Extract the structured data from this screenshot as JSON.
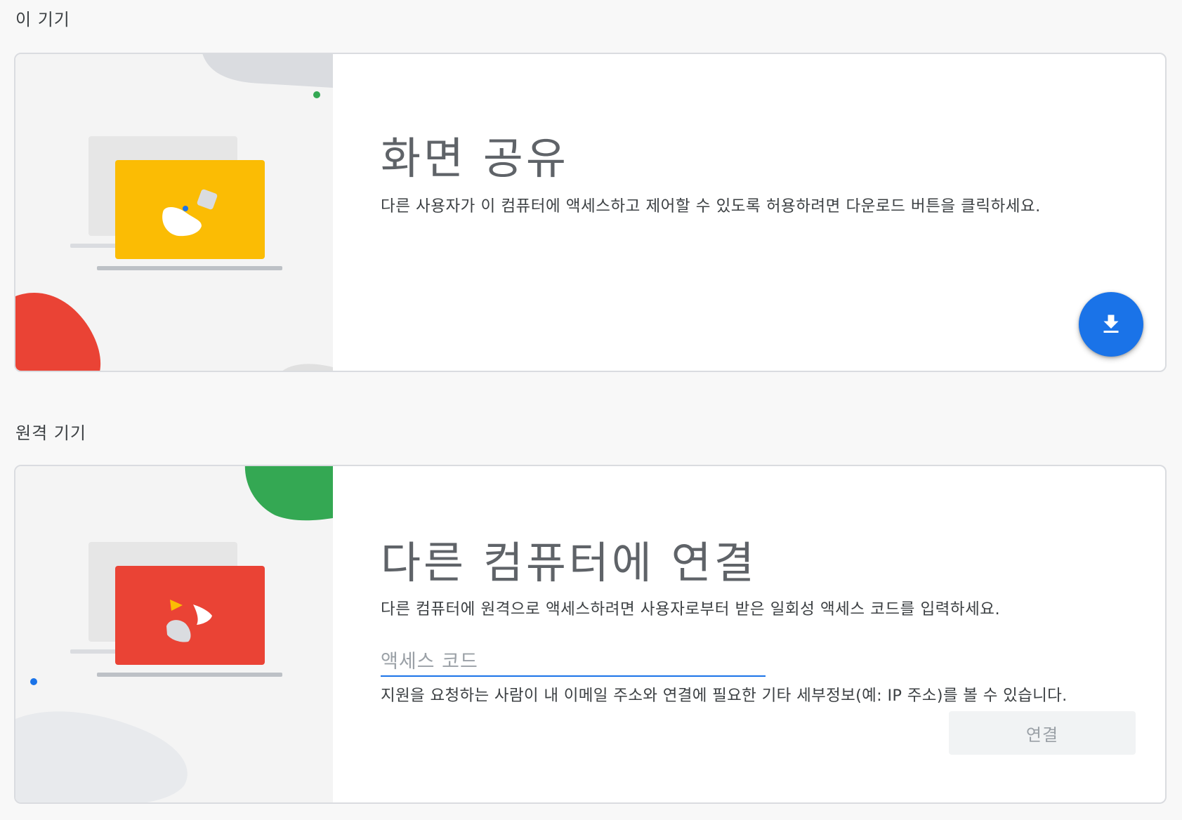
{
  "this_device": {
    "section_label": "이 기기",
    "card": {
      "title": "화면 공유",
      "description": "다른 사용자가 이 컴퓨터에 액세스하고 제어할 수 있도록 허용하려면 다운로드 버튼을 클릭하세요.",
      "download_icon": "download-icon"
    }
  },
  "remote_device": {
    "section_label": "원격 기기",
    "card": {
      "title": "다른 컴퓨터에 연결",
      "description": "다른 컴퓨터에 원격으로 액세스하려면 사용자로부터 받은 일회성 액세스 코드를 입력하세요.",
      "access_code": {
        "value": "",
        "placeholder": "액세스 코드"
      },
      "hint": "지원을 요청하는 사람이 내 이메일 주소와 연결에 필요한 기타 세부정보(예: IP 주소)를 볼 수 있습니다.",
      "connect_label": "연결"
    }
  },
  "colors": {
    "accent_blue": "#1a73e8",
    "yellow": "#fbbc04",
    "red": "#ea4335",
    "green": "#34a853"
  }
}
